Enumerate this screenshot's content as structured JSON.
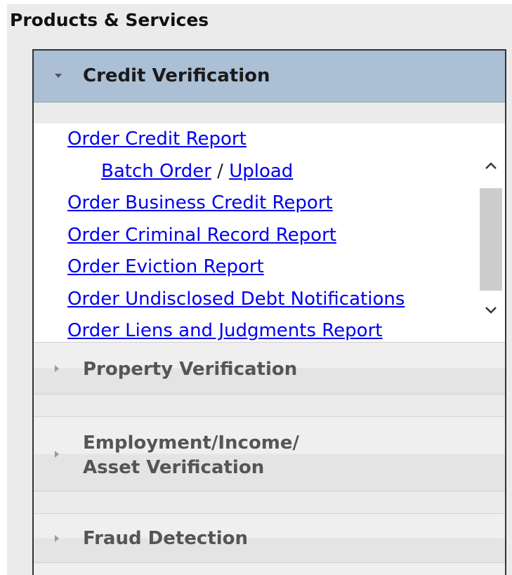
{
  "page": {
    "title": "Products & Services"
  },
  "sections": [
    {
      "label": "Credit Verification",
      "state": "expanded",
      "links": [
        {
          "text": "Order Credit Report"
        },
        {
          "batch": "Batch Order",
          "separator": "/",
          "upload": "Upload"
        },
        {
          "text": "Order Business Credit Report"
        },
        {
          "text": "Order Criminal Record Report"
        },
        {
          "text": "Order Eviction Report"
        },
        {
          "text": "Order Undisclosed Debt Notifications"
        },
        {
          "text": "Order Liens and Judgments Report"
        }
      ]
    },
    {
      "label": "Property Verification",
      "state": "collapsed"
    },
    {
      "label_line1": "Employment/Income/",
      "label_line2": "Asset Verification",
      "state": "collapsed"
    },
    {
      "label": "Fraud Detection",
      "state": "collapsed"
    }
  ],
  "colors": {
    "link": "#0000ee",
    "header_active": "#abbfd5",
    "panel_bg": "#ebebeb"
  },
  "icons": {
    "expanded": "caret-down-icon",
    "collapsed": "caret-right-icon",
    "scroll_up": "chevron-up-icon",
    "scroll_down": "chevron-down-icon"
  }
}
